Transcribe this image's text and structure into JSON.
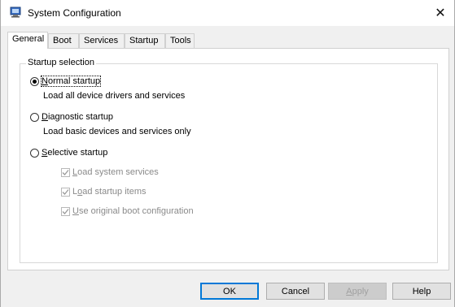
{
  "window": {
    "title": "System Configuration",
    "icon": "system-configuration-icon",
    "close_glyph": "✕"
  },
  "tabs": [
    {
      "label": "General",
      "active": true
    },
    {
      "label": "Boot",
      "active": false
    },
    {
      "label": "Services",
      "active": false
    },
    {
      "label": "Startup",
      "active": false
    },
    {
      "label": "Tools",
      "active": false
    }
  ],
  "startup_selection": {
    "legend": "Startup selection",
    "normal": {
      "first_char": "N",
      "rest": "ormal startup",
      "description": "Load all device drivers and services",
      "selected": true
    },
    "diagnostic": {
      "first_char": "D",
      "rest": "iagnostic startup",
      "description": "Load basic devices and services only",
      "selected": false
    },
    "selective": {
      "first_char": "S",
      "rest": "elective startup",
      "selected": false
    },
    "options": [
      {
        "prefix": "",
        "ukey": "L",
        "rest": "oad system services",
        "checked": true,
        "enabled": false
      },
      {
        "prefix": "L",
        "ukey": "o",
        "rest": "ad startup items",
        "checked": true,
        "enabled": false
      },
      {
        "prefix": "",
        "ukey": "U",
        "rest": "se original boot configuration",
        "checked": true,
        "enabled": false
      }
    ]
  },
  "buttons": {
    "ok": "OK",
    "cancel": "Cancel",
    "apply_first": "A",
    "apply_rest": "pply",
    "help": "Help"
  },
  "colors": {
    "focus_border": "#0078d7",
    "disabled_text": "#8a8a8a"
  }
}
